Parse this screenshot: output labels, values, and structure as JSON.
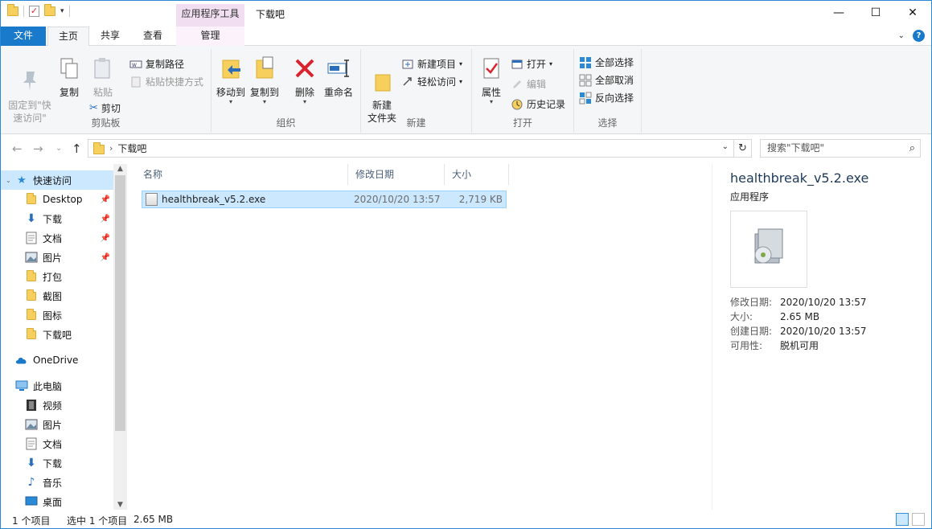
{
  "window": {
    "title": "下载吧",
    "context_tab_header": "应用程序工具"
  },
  "tabs": {
    "file": "文件",
    "home": "主页",
    "share": "共享",
    "view": "查看",
    "manage": "管理"
  },
  "ribbon": {
    "clipboard": {
      "label": "剪贴板",
      "pin": "固定到\"快\n速访问\"",
      "copy": "复制",
      "paste": "粘贴",
      "copy_path": "复制路径",
      "paste_shortcut": "粘贴快捷方式",
      "cut": "剪切"
    },
    "organize": {
      "label": "组织",
      "move_to": "移动到",
      "copy_to": "复制到",
      "delete": "删除",
      "rename": "重命名"
    },
    "new": {
      "label": "新建",
      "new_folder": "新建\n文件夹",
      "new_item": "新建项目",
      "easy_access": "轻松访问"
    },
    "open": {
      "label": "打开",
      "properties": "属性",
      "open": "打开",
      "edit": "编辑",
      "history": "历史记录"
    },
    "select": {
      "label": "选择",
      "select_all": "全部选择",
      "select_none": "全部取消",
      "invert": "反向选择"
    }
  },
  "address": {
    "path": "下载吧",
    "search_placeholder": "搜索\"下载吧\""
  },
  "nav": {
    "items": [
      {
        "label": "快速访问",
        "icon": "star-icon"
      },
      {
        "label": "Desktop",
        "icon": "folder-icon",
        "pinned": true
      },
      {
        "label": "下载",
        "icon": "download-arrow-icon",
        "pinned": true
      },
      {
        "label": "文档",
        "icon": "document-icon",
        "pinned": true
      },
      {
        "label": "图片",
        "icon": "picture-icon",
        "pinned": true
      },
      {
        "label": "打包",
        "icon": "folder-icon"
      },
      {
        "label": "截图",
        "icon": "folder-icon"
      },
      {
        "label": "图标",
        "icon": "folder-icon"
      },
      {
        "label": "下载吧",
        "icon": "folder-icon"
      },
      {
        "label": "OneDrive",
        "icon": "cloud-icon"
      },
      {
        "label": "此电脑",
        "icon": "computer-icon"
      },
      {
        "label": "视频",
        "icon": "video-icon"
      },
      {
        "label": "图片",
        "icon": "picture-icon"
      },
      {
        "label": "文档",
        "icon": "document-icon"
      },
      {
        "label": "下载",
        "icon": "download-arrow-icon"
      },
      {
        "label": "音乐",
        "icon": "music-icon"
      },
      {
        "label": "桌面",
        "icon": "desktop-icon"
      }
    ]
  },
  "filelist": {
    "headers": {
      "name": "名称",
      "date": "修改日期",
      "size": "大小"
    },
    "rows": [
      {
        "name": "healthbreak_v5.2.exe",
        "date": "2020/10/20 13:57",
        "size": "2,719 KB"
      }
    ]
  },
  "details": {
    "title": "healthbreak_v5.2.exe",
    "type": "应用程序",
    "modified_label": "修改日期:",
    "modified_value": "2020/10/20 13:57",
    "size_label": "大小:",
    "size_value": "2.65 MB",
    "created_label": "创建日期:",
    "created_value": "2020/10/20 13:57",
    "availability_label": "可用性:",
    "availability_value": "脱机可用"
  },
  "status": {
    "count": "1 个项目",
    "selected": "选中 1 个项目",
    "selected_size": "2.65 MB"
  },
  "colors": {
    "accent": "#1979ca",
    "selection": "#cce8ff",
    "context_tab": "#f1dff1"
  }
}
